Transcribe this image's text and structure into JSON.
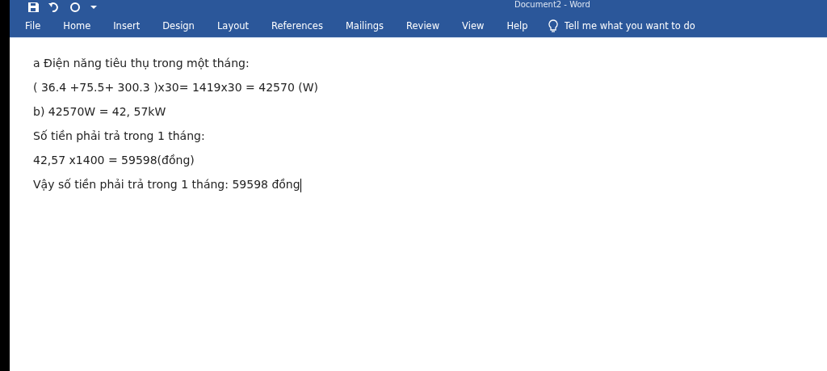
{
  "window": {
    "title": "Document2 - Word"
  },
  "ribbon_tabs": [
    {
      "label": "File"
    },
    {
      "label": "Home"
    },
    {
      "label": "Insert"
    },
    {
      "label": "Design"
    },
    {
      "label": "Layout"
    },
    {
      "label": "References"
    },
    {
      "label": "Mailings"
    },
    {
      "label": "Review"
    },
    {
      "label": "View"
    },
    {
      "label": "Help"
    }
  ],
  "tell_me": {
    "placeholder": "Tell me what you want to do"
  },
  "document": {
    "paragraphs": [
      "a Điện năng tiêu thụ trong một tháng:",
      "( 36.4 +75.5+ 300.3 )x30= 1419x30 = 42570 (W)",
      "b) 42570W = 42, 57kW",
      "Số tiền phải trả trong 1 tháng:",
      "42,57 x1400 = 59598(đồng)",
      "Vậy số tiền phải trả trong 1 tháng: 59598 đồng"
    ]
  }
}
